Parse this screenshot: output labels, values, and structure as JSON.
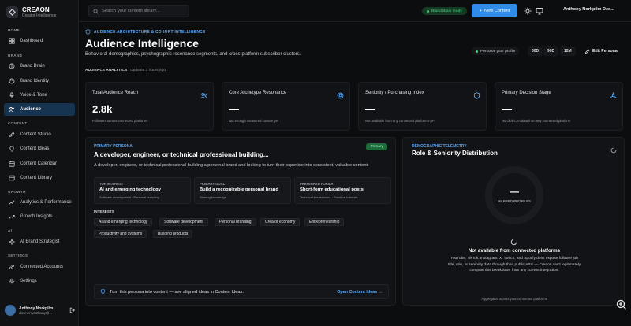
{
  "brand": {
    "name": "CREAON",
    "subtitle": "Creator Intelligence"
  },
  "sidebar": {
    "sections": {
      "home": "HOME",
      "brand": "BRAND",
      "content": "CONTENT",
      "growth": "GROWTH",
      "ai": "AI",
      "settings": "SETTINGS"
    },
    "items": {
      "dashboard": "Dashboard",
      "brand_brain": "Brand Brain",
      "brand_identity": "Brand Identity",
      "voice_tone": "Voice & Tone",
      "audience": "Audience",
      "content_studio": "Content Studio",
      "content_ideas": "Content Ideas",
      "content_calendar": "Content Calendar",
      "content_library": "Content Library",
      "analytics": "Analytics & Performance",
      "growth_insights": "Growth Insights",
      "ai_strategist": "AI Brand Strategist",
      "connected_accounts": "Connected Accounts",
      "settings": "Settings"
    },
    "user": {
      "name": "Anthony Norkpilm...",
      "email": "dosmerryanthony@..."
    }
  },
  "topbar": {
    "search_placeholder": "Search your content library...",
    "status": "Brand Brain ready",
    "new_content": "New Content",
    "user_name": "Anthony Norkpilm Dzo..."
  },
  "header": {
    "eyebrow": "AUDIENCE ARCHITECTURE & COHORT INTELLIGENCE",
    "title": "Audience Intelligence",
    "subtitle": "Behavioral demographics, psychographic resonance segments, and cross-platform subscriber clusters.",
    "persona_status": "Persona: your profile",
    "ranges": [
      "30D",
      "90D",
      "12M"
    ],
    "edit_persona": "Edit Persona"
  },
  "analytics": {
    "label": "AUDIENCE ANALYTICS",
    "updated": "Updated 2 hours ago"
  },
  "stats": [
    {
      "title": "Total Audience Reach",
      "value": "2.8k",
      "note": "Followers across connected platforms",
      "icon": "users-icon"
    },
    {
      "title": "Core Archetype Resonance",
      "value": "—",
      "note": "Not enough measured content yet",
      "icon": "target-icon"
    },
    {
      "title": "Seniority / Purchasing Index",
      "value": "—",
      "note": "Not available from any connected platform's API",
      "icon": "shield-icon"
    },
    {
      "title": "Primary Decision Stage",
      "value": "—",
      "note": "No click/CTA data from any connected platform",
      "icon": "network-icon"
    }
  ],
  "persona": {
    "eyebrow": "PRIMARY PERSONA",
    "badge": "Primary",
    "title": "A developer, engineer, or technical professional building...",
    "description": "A developer, engineer, or technical professional building a personal brand and looking to turn their expertise into consistent, valuable content.",
    "cards": [
      {
        "label": "TOP INTEREST",
        "value": "AI and emerging technology",
        "sub": "Software development · Personal branding"
      },
      {
        "label": "PRIMARY GOAL",
        "value": "Build a recognizable personal brand",
        "sub": "Sharing knowledge"
      },
      {
        "label": "PREFERRED FORMAT",
        "value": "Short-form educational posts",
        "sub": "Technical breakdowns · Practical tutorials"
      }
    ],
    "interests_label": "INTERESTS",
    "interests": [
      "AI and emerging technology",
      "Software development",
      "Personal branding",
      "Creator economy",
      "Entrepreneurship",
      "Productivity and systems",
      "Building products"
    ],
    "cta_text": "Turn this persona into content — see aligned ideas in Content Ideas.",
    "cta_link": "Open Content Ideas →"
  },
  "demographics": {
    "eyebrow": "DEMOGRAPHIC TELEMETRY",
    "title": "Role & Seniority Distribution",
    "ring_value": "—",
    "ring_label": "MAPPED PROFILES",
    "na_title": "Not available from connected platforms",
    "na_desc": "YouTube, TikTok, Instagram, X, Twitch, and Spotify don't expose follower job title, role, or seniority data through their public APIs — Creaon can't legitimately compute this breakdown from any current integration.",
    "footer": "Aggregated across your connected platforms"
  },
  "colors": {
    "accent": "#2f8ce8",
    "active_nav": "#163450",
    "success": "#4ad07f"
  }
}
